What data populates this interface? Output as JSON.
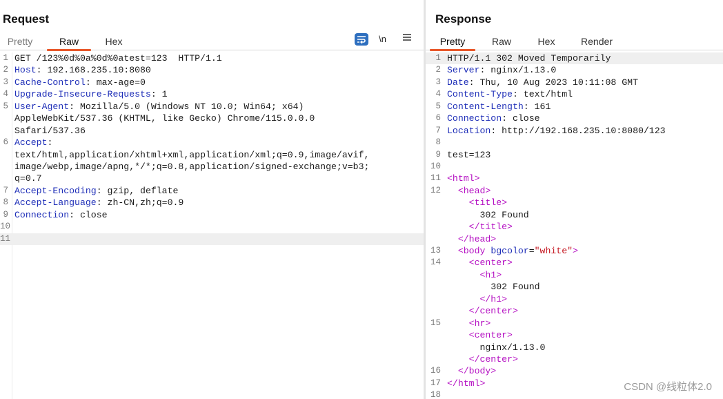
{
  "request": {
    "title": "Request",
    "tabs": [
      "Pretty",
      "Raw",
      "Hex"
    ],
    "active_tab": 1,
    "tools": {
      "wrap_icon": "text-wrap-icon",
      "newline": "\\n",
      "menu_icon": "hamburger-menu-icon"
    },
    "lines": [
      {
        "n": "1",
        "segs": [
          {
            "t": "GET /123%0d%0a%0d%0atest=123  HTTP/1.1"
          }
        ]
      },
      {
        "n": "2",
        "segs": [
          {
            "t": "Host",
            "c": "k"
          },
          {
            "t": ": 192.168.235.10:8080"
          }
        ]
      },
      {
        "n": "3",
        "segs": [
          {
            "t": "Cache-Control",
            "c": "k"
          },
          {
            "t": ": max-age=0"
          }
        ]
      },
      {
        "n": "4",
        "segs": [
          {
            "t": "Upgrade-Insecure-Requests",
            "c": "k"
          },
          {
            "t": ": 1"
          }
        ]
      },
      {
        "n": "5",
        "segs": [
          {
            "t": "User-Agent",
            "c": "k"
          },
          {
            "t": ": Mozilla/5.0 (Windows NT 10.0; Win64; x64)"
          }
        ]
      },
      {
        "n": "",
        "segs": [
          {
            "t": "AppleWebKit/537.36 (KHTML, like Gecko) Chrome/115.0.0.0"
          }
        ]
      },
      {
        "n": "",
        "segs": [
          {
            "t": "Safari/537.36"
          }
        ]
      },
      {
        "n": "6",
        "segs": [
          {
            "t": "Accept",
            "c": "k"
          },
          {
            "t": ":"
          }
        ]
      },
      {
        "n": "",
        "segs": [
          {
            "t": "text/html,application/xhtml+xml,application/xml;q=0.9,image/avif,"
          }
        ]
      },
      {
        "n": "",
        "segs": [
          {
            "t": "image/webp,image/apng,*/*;q=0.8,application/signed-exchange;v=b3;"
          }
        ]
      },
      {
        "n": "",
        "segs": [
          {
            "t": "q=0.7"
          }
        ]
      },
      {
        "n": "7",
        "segs": [
          {
            "t": "Accept-Encoding",
            "c": "k"
          },
          {
            "t": ": gzip, deflate"
          }
        ]
      },
      {
        "n": "8",
        "segs": [
          {
            "t": "Accept-Language",
            "c": "k"
          },
          {
            "t": ": zh-CN,zh;q=0.9"
          }
        ]
      },
      {
        "n": "9",
        "segs": [
          {
            "t": "Connection",
            "c": "k"
          },
          {
            "t": ": close"
          }
        ]
      },
      {
        "n": "10",
        "segs": []
      },
      {
        "n": "11",
        "segs": [],
        "current": true
      }
    ]
  },
  "response": {
    "title": "Response",
    "tabs": [
      "Pretty",
      "Raw",
      "Hex",
      "Render"
    ],
    "active_tab": 0,
    "lines": [
      {
        "n": "1",
        "segs": [
          {
            "t": "HTTP/1.1 302 Moved Temporarily"
          }
        ],
        "current": true
      },
      {
        "n": "2",
        "segs": [
          {
            "t": "Server",
            "c": "k"
          },
          {
            "t": ": nginx/1.13.0"
          }
        ]
      },
      {
        "n": "3",
        "segs": [
          {
            "t": "Date",
            "c": "k"
          },
          {
            "t": ": Thu, 10 Aug 2023 10:11:08 GMT"
          }
        ]
      },
      {
        "n": "4",
        "segs": [
          {
            "t": "Content-Type",
            "c": "k"
          },
          {
            "t": ": text/html"
          }
        ]
      },
      {
        "n": "5",
        "segs": [
          {
            "t": "Content-Length",
            "c": "k"
          },
          {
            "t": ": 161"
          }
        ]
      },
      {
        "n": "6",
        "segs": [
          {
            "t": "Connection",
            "c": "k"
          },
          {
            "t": ": close"
          }
        ]
      },
      {
        "n": "7",
        "segs": [
          {
            "t": "Location",
            "c": "k"
          },
          {
            "t": ": http://192.168.235.10:8080/123"
          }
        ]
      },
      {
        "n": "8",
        "segs": []
      },
      {
        "n": "9",
        "segs": [
          {
            "t": "test=123"
          }
        ]
      },
      {
        "n": "10",
        "segs": []
      },
      {
        "n": "11",
        "segs": [
          {
            "t": "<html>",
            "c": "t"
          }
        ]
      },
      {
        "n": "12",
        "segs": [
          {
            "t": "  "
          },
          {
            "t": "<head>",
            "c": "t"
          }
        ]
      },
      {
        "n": "",
        "segs": [
          {
            "t": "    "
          },
          {
            "t": "<title>",
            "c": "t"
          }
        ]
      },
      {
        "n": "",
        "segs": [
          {
            "t": "      302 Found"
          }
        ]
      },
      {
        "n": "",
        "segs": [
          {
            "t": "    "
          },
          {
            "t": "</title>",
            "c": "t"
          }
        ]
      },
      {
        "n": "",
        "segs": [
          {
            "t": "  "
          },
          {
            "t": "</head>",
            "c": "t"
          }
        ]
      },
      {
        "n": "13",
        "segs": [
          {
            "t": "  "
          },
          {
            "t": "<body ",
            "c": "t"
          },
          {
            "t": "bgcolor",
            "c": "a"
          },
          {
            "t": "="
          },
          {
            "t": "\"white\"",
            "c": "s"
          },
          {
            "t": ">",
            "c": "t"
          }
        ]
      },
      {
        "n": "14",
        "segs": [
          {
            "t": "    "
          },
          {
            "t": "<center>",
            "c": "t"
          }
        ]
      },
      {
        "n": "",
        "segs": [
          {
            "t": "      "
          },
          {
            "t": "<h1>",
            "c": "t"
          }
        ]
      },
      {
        "n": "",
        "segs": [
          {
            "t": "        302 Found"
          }
        ]
      },
      {
        "n": "",
        "segs": [
          {
            "t": "      "
          },
          {
            "t": "</h1>",
            "c": "t"
          }
        ]
      },
      {
        "n": "",
        "segs": [
          {
            "t": "    "
          },
          {
            "t": "</center>",
            "c": "t"
          }
        ]
      },
      {
        "n": "15",
        "segs": [
          {
            "t": "    "
          },
          {
            "t": "<hr>",
            "c": "t"
          }
        ]
      },
      {
        "n": "",
        "segs": [
          {
            "t": "    "
          },
          {
            "t": "<center>",
            "c": "t"
          }
        ]
      },
      {
        "n": "",
        "segs": [
          {
            "t": "      nginx/1.13.0"
          }
        ]
      },
      {
        "n": "",
        "segs": [
          {
            "t": "    "
          },
          {
            "t": "</center>",
            "c": "t"
          }
        ]
      },
      {
        "n": "16",
        "segs": [
          {
            "t": "  "
          },
          {
            "t": "</body>",
            "c": "t"
          }
        ]
      },
      {
        "n": "17",
        "segs": [
          {
            "t": "</html>",
            "c": "t"
          }
        ]
      },
      {
        "n": "18",
        "segs": []
      }
    ]
  },
  "watermark": "CSDN @线粒体2.0",
  "colors": {
    "accent_underline": "#e8582b",
    "header_name": "#1f2fb8",
    "tag": "#b40ec2",
    "attr_value": "#c4141e",
    "wrap_button": "#2e6fbf"
  }
}
